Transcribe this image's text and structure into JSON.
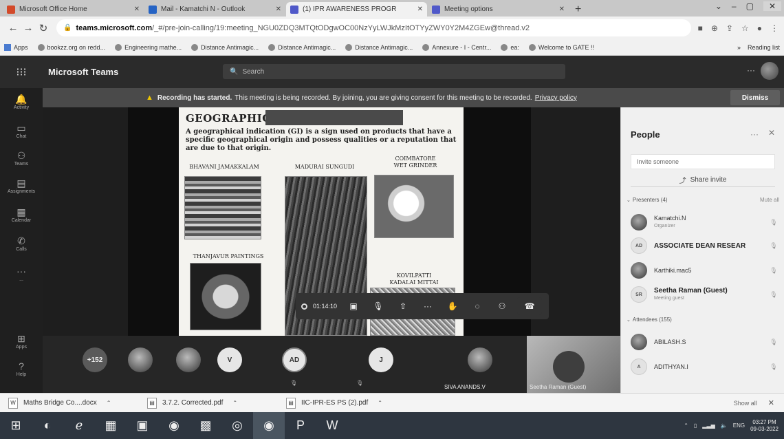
{
  "browser": {
    "tabs": [
      {
        "title": "Microsoft Office Home",
        "icon_color": "#d34a2a"
      },
      {
        "title": "Mail - Kamatchi N - Outlook",
        "icon_color": "#2563c4"
      },
      {
        "title": "(1) IPR AWARENESS PROGR",
        "icon_color": "#5059c9",
        "active": true
      },
      {
        "title": "Meeting options",
        "icon_color": "#5059c9"
      }
    ],
    "new_tab": "+",
    "url_host": "teams.microsoft.com",
    "url_path": "/_#/pre-join-calling/19:meeting_NGU0ZDQ3MTQtODgwOC00NzYyLWJkMzItOTYyZWY0Y2M4ZGEw@thread.v2",
    "bookmarks": [
      "Apps",
      "bookzz.org on redd...",
      "Engineering mathe...",
      "Distance Antimagic...",
      "Distance Antimagic...",
      "Distance Antimagic...",
      "Annexure - I - Centr...",
      "ea:",
      "Welcome to GATE !!"
    ],
    "bookmarks_right": [
      "»",
      "Reading list"
    ]
  },
  "teams": {
    "app_title": "Microsoft Teams",
    "search_placeholder": "Search",
    "rail": [
      {
        "label": "Activity",
        "icon": "bell-icon"
      },
      {
        "label": "Chat",
        "icon": "chat-icon"
      },
      {
        "label": "Teams",
        "icon": "teams-icon"
      },
      {
        "label": "Assignments",
        "icon": "assignments-icon"
      },
      {
        "label": "Calendar",
        "icon": "calendar-icon"
      },
      {
        "label": "Calls",
        "icon": "calls-icon"
      },
      {
        "label": "...",
        "icon": "more-icon"
      },
      {
        "label": "Apps",
        "icon": "apps-icon"
      },
      {
        "label": "Help",
        "icon": "help-icon"
      }
    ],
    "banner": {
      "bold": "Recording has started.",
      "text": "This meeting is being recorded. By joining, you are giving consent for this meeting to be recorded.",
      "link": "Privacy policy",
      "dismiss": "Dismiss"
    }
  },
  "slide": {
    "title": "GEOGRAPHIC",
    "definition": "A geographical indication (GI) is a sign used on products that have a specific geographical origin and possess qualities or a reputation that are due to that origin.",
    "captions": {
      "bhavani": "BHAVANI JAMAKKALAM",
      "madurai": "MADURAI SUNGUDI",
      "coimbatore": "COIMBATORE\nWET GRINDER",
      "thanjavur": "THANJAVUR PAINTINGS",
      "kovilpatti": "KOVILPATTI\nKADALAI MITTAI"
    }
  },
  "callbar": {
    "timer": "01:14:10"
  },
  "participants_strip": {
    "more": "+152",
    "initials": [
      "V",
      "AD",
      "J"
    ],
    "names": [
      "SIVA ANANDS.V",
      "Seetha Raman (Guest)"
    ]
  },
  "people": {
    "title": "People",
    "invite_placeholder": "Invite someone",
    "share_invite": "Share invite",
    "presenters_header": "Presenters (4)",
    "mute_all": "Mute all",
    "presenters": [
      {
        "name": "Kamatchi.N",
        "sub": "Organizer",
        "avatar": "photo"
      },
      {
        "name": "ASSOCIATE DEAN RESEAR",
        "sub": "",
        "avatar": "init",
        "initials": "AD",
        "bold": true
      },
      {
        "name": "Karthiki.mac5",
        "sub": "",
        "avatar": "photo"
      },
      {
        "name": "Seetha Raman (Guest)",
        "sub": "Meeting guest",
        "avatar": "init",
        "initials": "SR",
        "bold": true
      }
    ],
    "attendees_header": "Attendees (155)",
    "attendees": [
      {
        "name": "ABILASH.S",
        "sub": "",
        "avatar": "photo"
      },
      {
        "name": "ADITHYAN.I",
        "sub": "",
        "avatar": "init",
        "initials": "A"
      }
    ]
  },
  "downloads": {
    "items": [
      "Maths Bridge Co....docx",
      "3.7.2. Corrected.pdf",
      "IIC-IPR-ES PS (2).pdf"
    ],
    "show_all": "Show all"
  },
  "taskbar": {
    "lang": "ENG",
    "time": "03:27 PM",
    "date": "09-03-2022"
  }
}
